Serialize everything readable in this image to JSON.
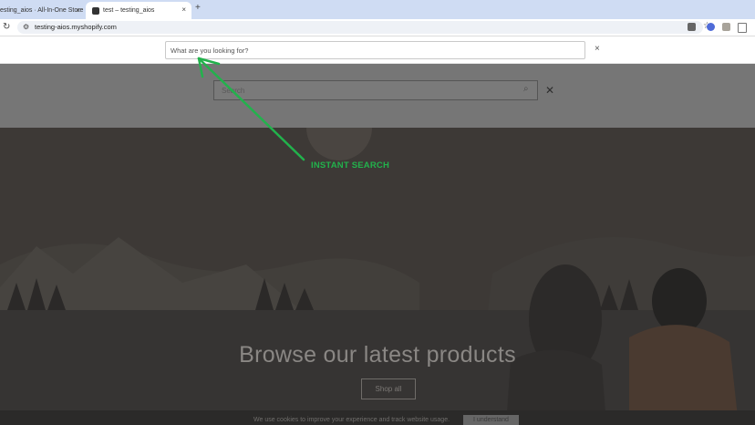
{
  "browser": {
    "tabs": [
      {
        "title": "esting_aios · All-In-One Store",
        "active": false
      },
      {
        "title": "test – testing_aios",
        "active": true
      }
    ],
    "tab_close_glyph": "×",
    "new_tab_glyph": "+",
    "url": "testing-aios.myshopify.com"
  },
  "instant_search": {
    "placeholder": "What are you looking for?",
    "close_glyph": "×"
  },
  "theme_search": {
    "placeholder": "Search",
    "close_glyph": "✕"
  },
  "hero": {
    "title": "Browse our latest products",
    "button_label": "Shop all"
  },
  "cookie_banner": {
    "text": "We use cookies to improve your experience and track website usage.",
    "button_label": "I understand"
  },
  "annotation": {
    "label": "INSTANT SEARCH",
    "color": "#22b24c"
  },
  "colors": {
    "tab_strip": "#cfdcf3",
    "hero_bg": "#3d3936",
    "dim_header": "#767676"
  }
}
